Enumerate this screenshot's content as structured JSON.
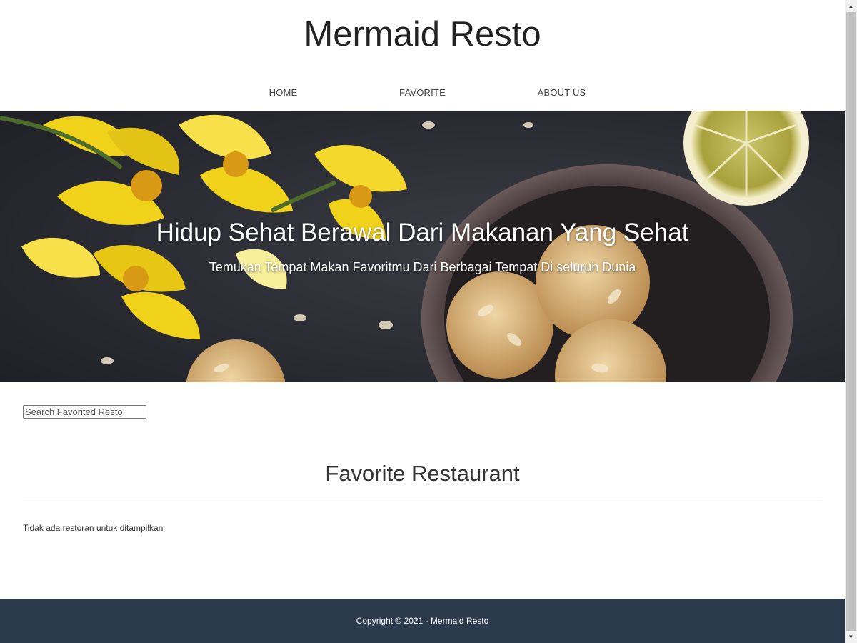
{
  "header": {
    "brand": "Mermaid Resto",
    "nav": [
      {
        "label": "HOME"
      },
      {
        "label": "FAVORITE"
      },
      {
        "label": "ABOUT US"
      }
    ]
  },
  "hero": {
    "title": "Hidup Sehat Berawal Dari Makanan Yang Sehat",
    "subtitle": "Temukan Tempat Makan Favoritmu Dari Berbagai Tempat Di seluruh Dunia"
  },
  "search": {
    "placeholder": "Search Favorited Resto",
    "value": ""
  },
  "main": {
    "section_title": "Favorite Restaurant",
    "empty_message": "Tidak ada restoran untuk ditampilkan"
  },
  "footer": {
    "copyright": "Copyright © 2021 - Mermaid Resto"
  },
  "colors": {
    "footer_bg": "#2c3a4d",
    "hero_dark": "#2a2b31",
    "flower_yellow": "#f1d21a"
  }
}
